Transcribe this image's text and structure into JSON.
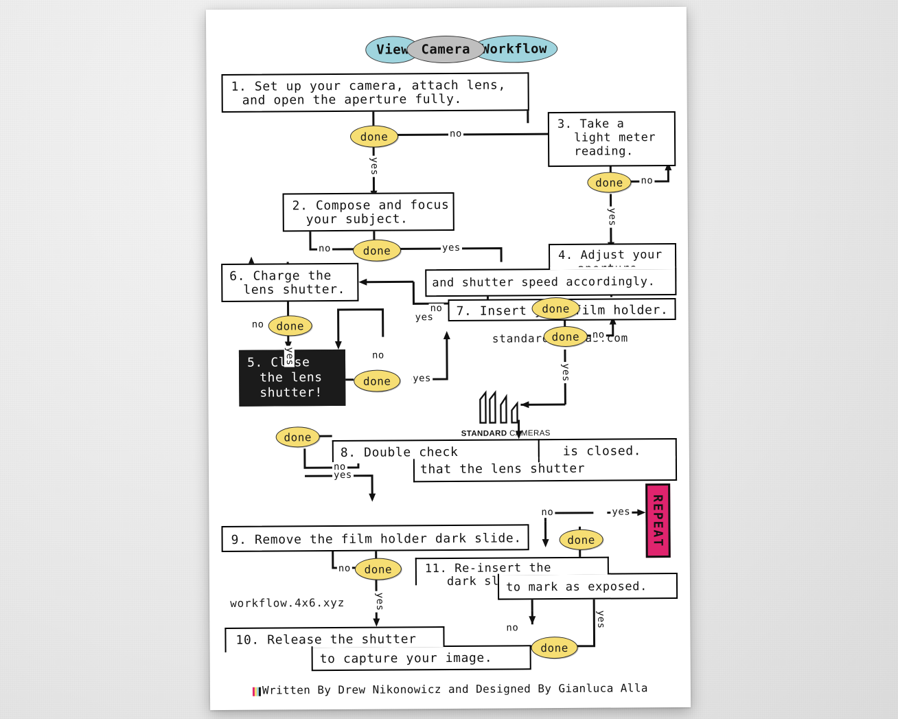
{
  "poster": {
    "header": {
      "pills": [
        {
          "label": "View",
          "color": "#9fd4de"
        },
        {
          "label": "Camera",
          "color": "#bfbfbf"
        },
        {
          "label": "Workflow",
          "color": "#9fd4de"
        }
      ]
    },
    "steps": [
      {
        "id": "s1",
        "lines": [
          "1. Set up your camera, attach lens,",
          "and open the aperture fully."
        ]
      },
      {
        "id": "s2",
        "lines": [
          "2. Compose and focus",
          "your subject."
        ]
      },
      {
        "id": "s3",
        "lines": [
          "3. Take a",
          "light meter",
          "reading."
        ]
      },
      {
        "id": "s4",
        "lines": [
          "4. Adjust your",
          "aperture",
          "and shutter speed accordingly."
        ]
      },
      {
        "id": "s5",
        "lines": [
          "5. Close",
          "the lens",
          "shutter!"
        ],
        "style": "dark"
      },
      {
        "id": "s6",
        "lines": [
          "6. Charge the",
          "lens shutter."
        ]
      },
      {
        "id": "s7",
        "lines": [
          "7. Insert your film holder."
        ]
      },
      {
        "id": "s8",
        "lines": [
          "8. Double check",
          "that the lens shutter",
          "is closed."
        ]
      },
      {
        "id": "s9",
        "lines": [
          "9. Remove the film holder dark slide."
        ]
      },
      {
        "id": "s10",
        "lines": [
          "10. Release the shutter",
          "to capture your image."
        ]
      },
      {
        "id": "s11",
        "lines": [
          "11. Re-insert the",
          "dark slide reversed,",
          "to mark as exposed."
        ]
      }
    ],
    "done_label": "done",
    "branch_labels": {
      "yes": "yes",
      "no": "no"
    },
    "repeat_badge": {
      "label": "REPEAT",
      "color": "#e0246e"
    },
    "urls": {
      "site": "standardcameras.com",
      "workflow": "workflow.4x6.xyz"
    },
    "logo": {
      "name_bold": "STANDARD",
      "name_light": " CAMERAS"
    },
    "footer": {
      "credit": "Written By Drew Nikonowicz and Designed By Gianluca Alla"
    },
    "colors": {
      "pill": "#f6de73",
      "header_blue": "#9fd4de",
      "header_gray": "#bfbfbf",
      "repeat": "#e0246e",
      "dark_box": "#1b1b1b"
    }
  }
}
